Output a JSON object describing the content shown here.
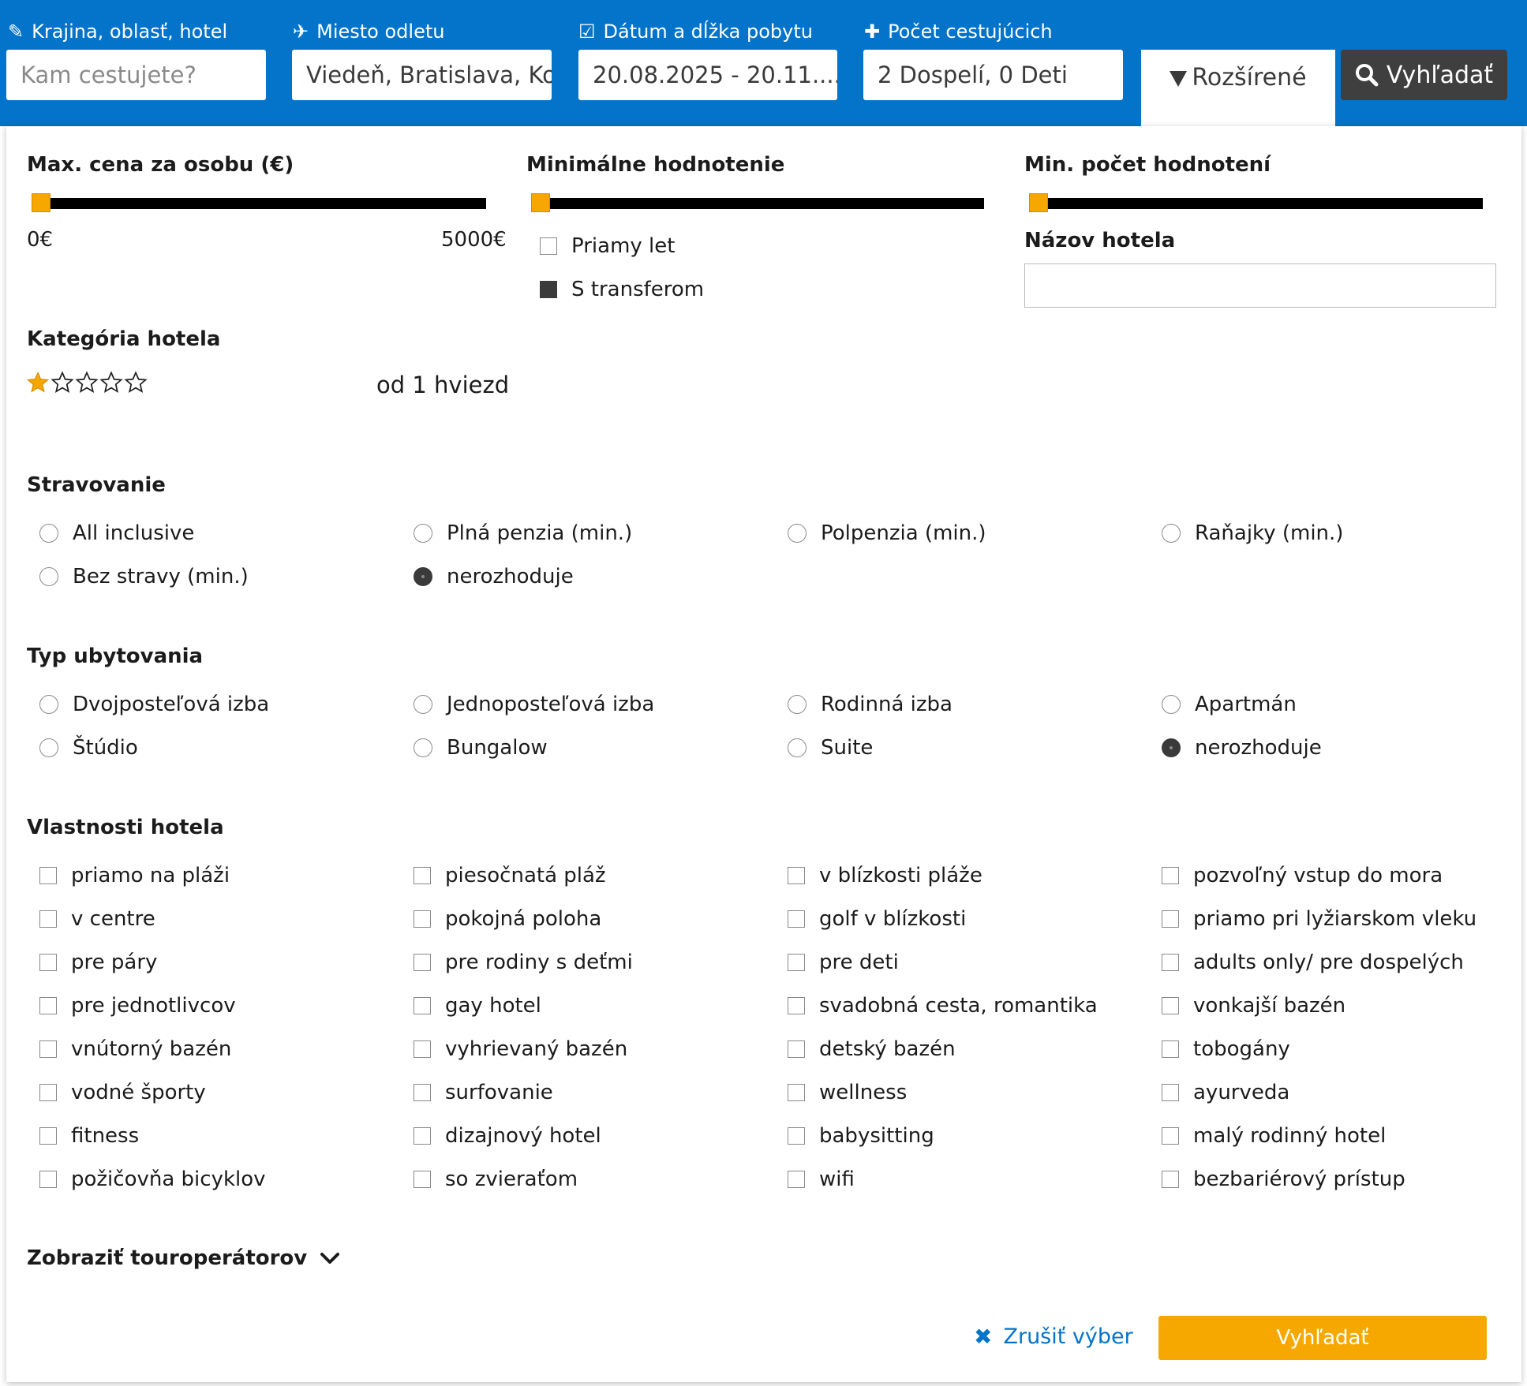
{
  "search_bar": {
    "destination": {
      "label": "Krajina, oblasť, hotel",
      "placeholder": "Kam cestujete?",
      "icon": "pencil-icon"
    },
    "departure": {
      "label": "Miesto odletu",
      "value": "Viedeň, Bratislava, Ko...",
      "icon": "plane-icon"
    },
    "dates": {
      "label": "Dátum a dĺžka pobytu",
      "value": "20.08.2025 - 20.11....",
      "icon": "checkbox-icon"
    },
    "travelers": {
      "label": "Počet cestujúcich",
      "value": "2 Dospelí, 0 Deti",
      "icon": "plus-icon"
    },
    "advanced_label": "Rozšírené",
    "search_label": "Vyhľadať"
  },
  "filters": {
    "max_price": {
      "label": "Max. cena za osobu (€)",
      "min_label": "0€",
      "max_label": "5000€",
      "value": 0
    },
    "min_rating": {
      "label": "Minimálne hodnotenie",
      "value": 0
    },
    "min_reviews": {
      "label": "Min. počet hodnotení",
      "value": 0
    },
    "flight_options": [
      {
        "label": "Priamy let",
        "checked": false
      },
      {
        "label": "S transferom",
        "checked": true
      }
    ],
    "hotel_name": {
      "label": "Názov hotela",
      "value": ""
    },
    "hotel_category": {
      "label": "Kategória hotela",
      "stars_selected": 1,
      "stars_total": 5,
      "caption": "od 1 hviezd"
    },
    "meals": {
      "label": "Stravovanie",
      "options": [
        {
          "label": "All inclusive",
          "selected": false
        },
        {
          "label": "Plná penzia (min.)",
          "selected": false
        },
        {
          "label": "Polpenzia (min.)",
          "selected": false
        },
        {
          "label": "Raňajky (min.)",
          "selected": false
        },
        {
          "label": "Bez stravy (min.)",
          "selected": false
        },
        {
          "label": "nerozhoduje",
          "selected": true
        }
      ]
    },
    "accommodation": {
      "label": "Typ ubytovania",
      "options": [
        {
          "label": "Dvojposteľová izba",
          "selected": false
        },
        {
          "label": "Jednoposteľová izba",
          "selected": false
        },
        {
          "label": "Rodinná izba",
          "selected": false
        },
        {
          "label": "Apartmán",
          "selected": false
        },
        {
          "label": "Štúdio",
          "selected": false
        },
        {
          "label": "Bungalow",
          "selected": false
        },
        {
          "label": "Suite",
          "selected": false
        },
        {
          "label": "nerozhoduje",
          "selected": true
        }
      ]
    },
    "features": {
      "label": "Vlastnosti hotela",
      "options": [
        "priamo na pláži",
        "piesočnatá pláž",
        "v blízkosti pláže",
        "pozvoľný vstup do mora",
        "v centre",
        "pokojná poloha",
        "golf v blízkosti",
        "priamo pri lyžiarskom vleku",
        "pre páry",
        "pre rodiny s deťmi",
        "pre deti",
        "adults only/ pre dospelých",
        "pre jednotlivcov",
        "gay hotel",
        "svadobná cesta, romantika",
        "vonkajší bazén",
        "vnútorný bazén",
        "vyhrievaný bazén",
        "detský bazén",
        "tobogány",
        "vodné športy",
        "surfovanie",
        "wellness",
        "ayurveda",
        "fitness",
        "dizajnový hotel",
        "babysitting",
        "malý rodinný hotel",
        "požičovňa bicyklov",
        "so zvieraťom",
        "wifi",
        "bezbariérový prístup"
      ]
    },
    "tour_operators_toggle": "Zobraziť touroperátorov",
    "cancel_label": "Zrušiť výber",
    "search_label": "Vyhľadať"
  },
  "colors": {
    "brand_blue": "#0374c9",
    "accent_orange": "#f6a800",
    "dark_button": "#3f3f3f"
  }
}
